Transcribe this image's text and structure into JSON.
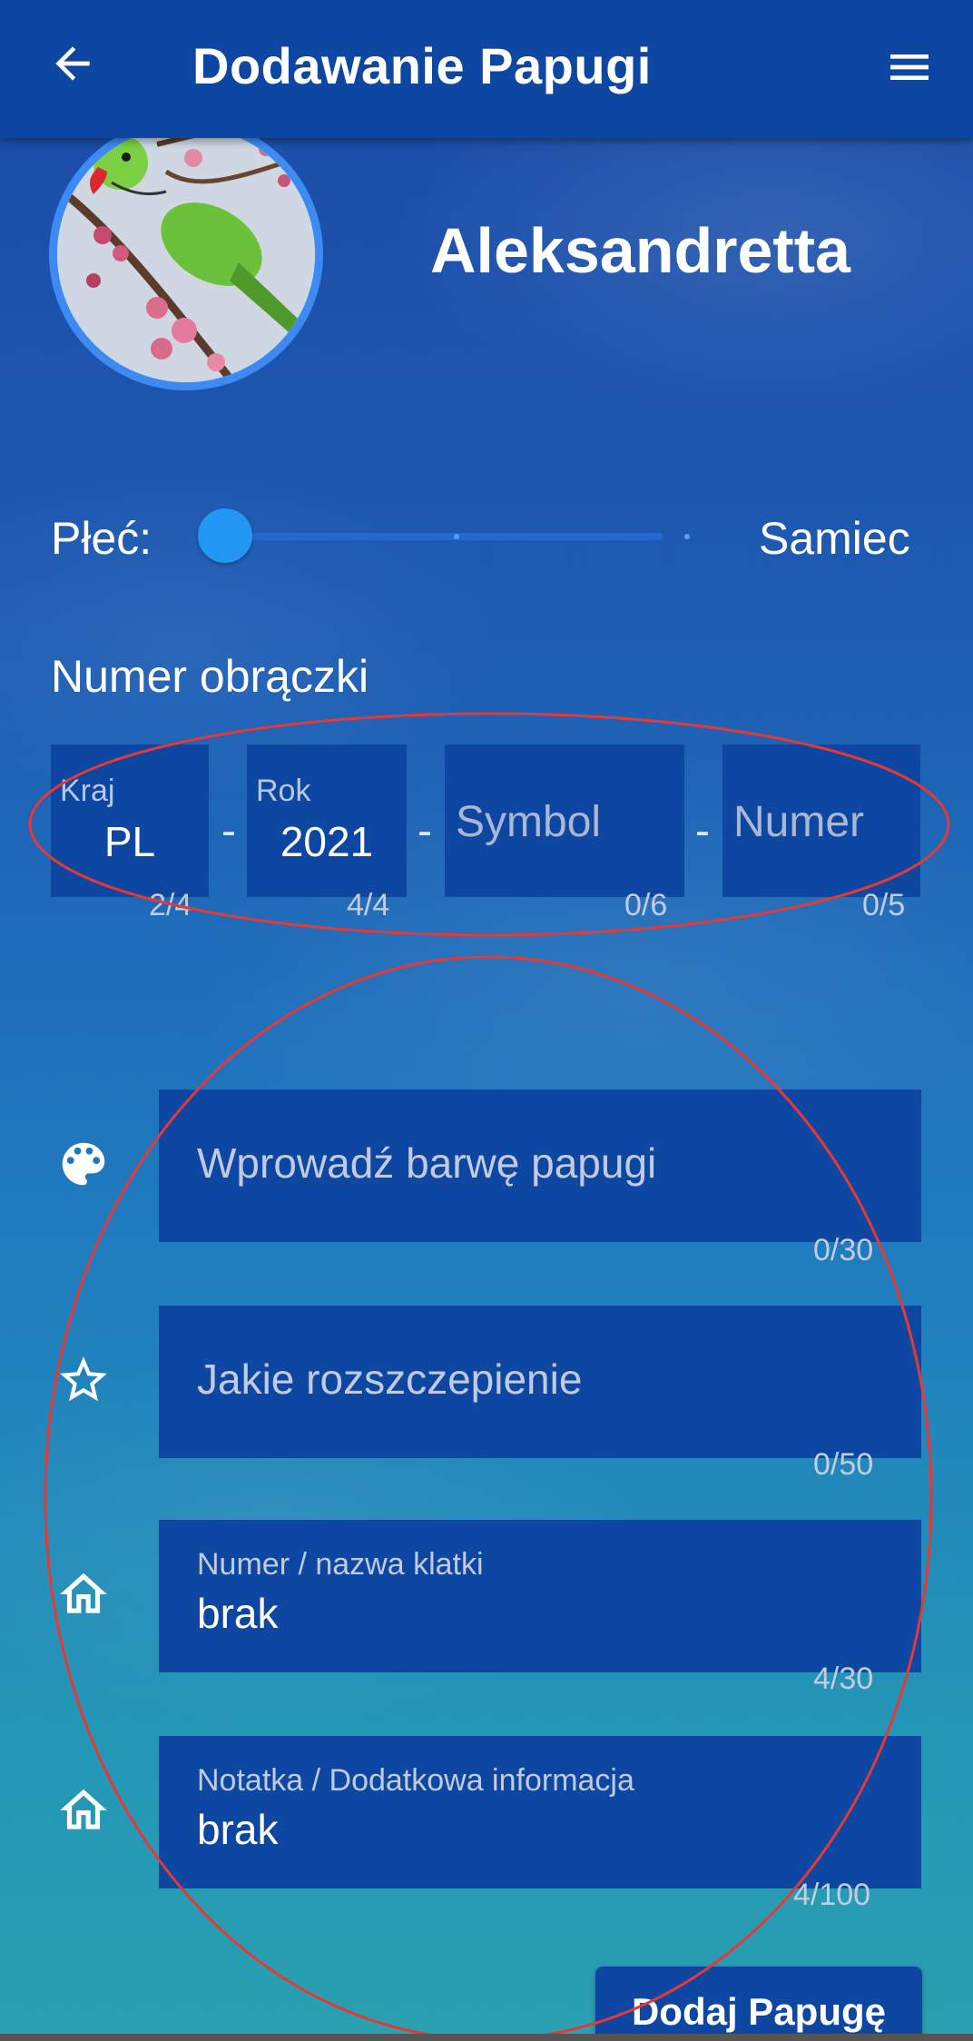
{
  "appbar": {
    "title": "Dodawanie Papugi",
    "back_icon": "arrow-left-icon",
    "menu_icon": "hamburger-menu-icon"
  },
  "parrot": {
    "species": "Aleksandretta",
    "photo": "parrot-photo"
  },
  "sex": {
    "label": "Płeć:",
    "value": "Samiec",
    "slider_position": 0,
    "slider_steps": 3
  },
  "ring": {
    "title": "Numer obrączki",
    "separator": "-",
    "fields": [
      {
        "label": "Kraj",
        "value": "PL",
        "placeholder": "",
        "counter": "2/4"
      },
      {
        "label": "Rok",
        "value": "2021",
        "placeholder": "",
        "counter": "4/4"
      },
      {
        "label": "",
        "value": "",
        "placeholder": "Symbol",
        "counter": "0/6"
      },
      {
        "label": "",
        "value": "",
        "placeholder": "Numer",
        "counter": "0/5"
      }
    ]
  },
  "form": {
    "color": {
      "icon": "palette-icon",
      "placeholder": "Wprowadź barwę papugi",
      "counter": "0/30"
    },
    "split": {
      "icon": "star-outline-icon",
      "placeholder": "Jakie rozszczepienie",
      "counter": "0/50"
    },
    "cage": {
      "icon": "home-icon",
      "label": "Numer / nazwa klatki",
      "value": "brak",
      "counter": "4/30"
    },
    "note": {
      "icon": "home-icon",
      "label": "Notatka / Dodatkowa informacja",
      "value": "brak",
      "counter": "4/100"
    }
  },
  "submit": {
    "label": "Dodaj Papugę"
  },
  "colors": {
    "appbar": "#0d47a1",
    "field": "#0d47a1",
    "accent": "#2196f3",
    "annotation": "#e53935"
  }
}
